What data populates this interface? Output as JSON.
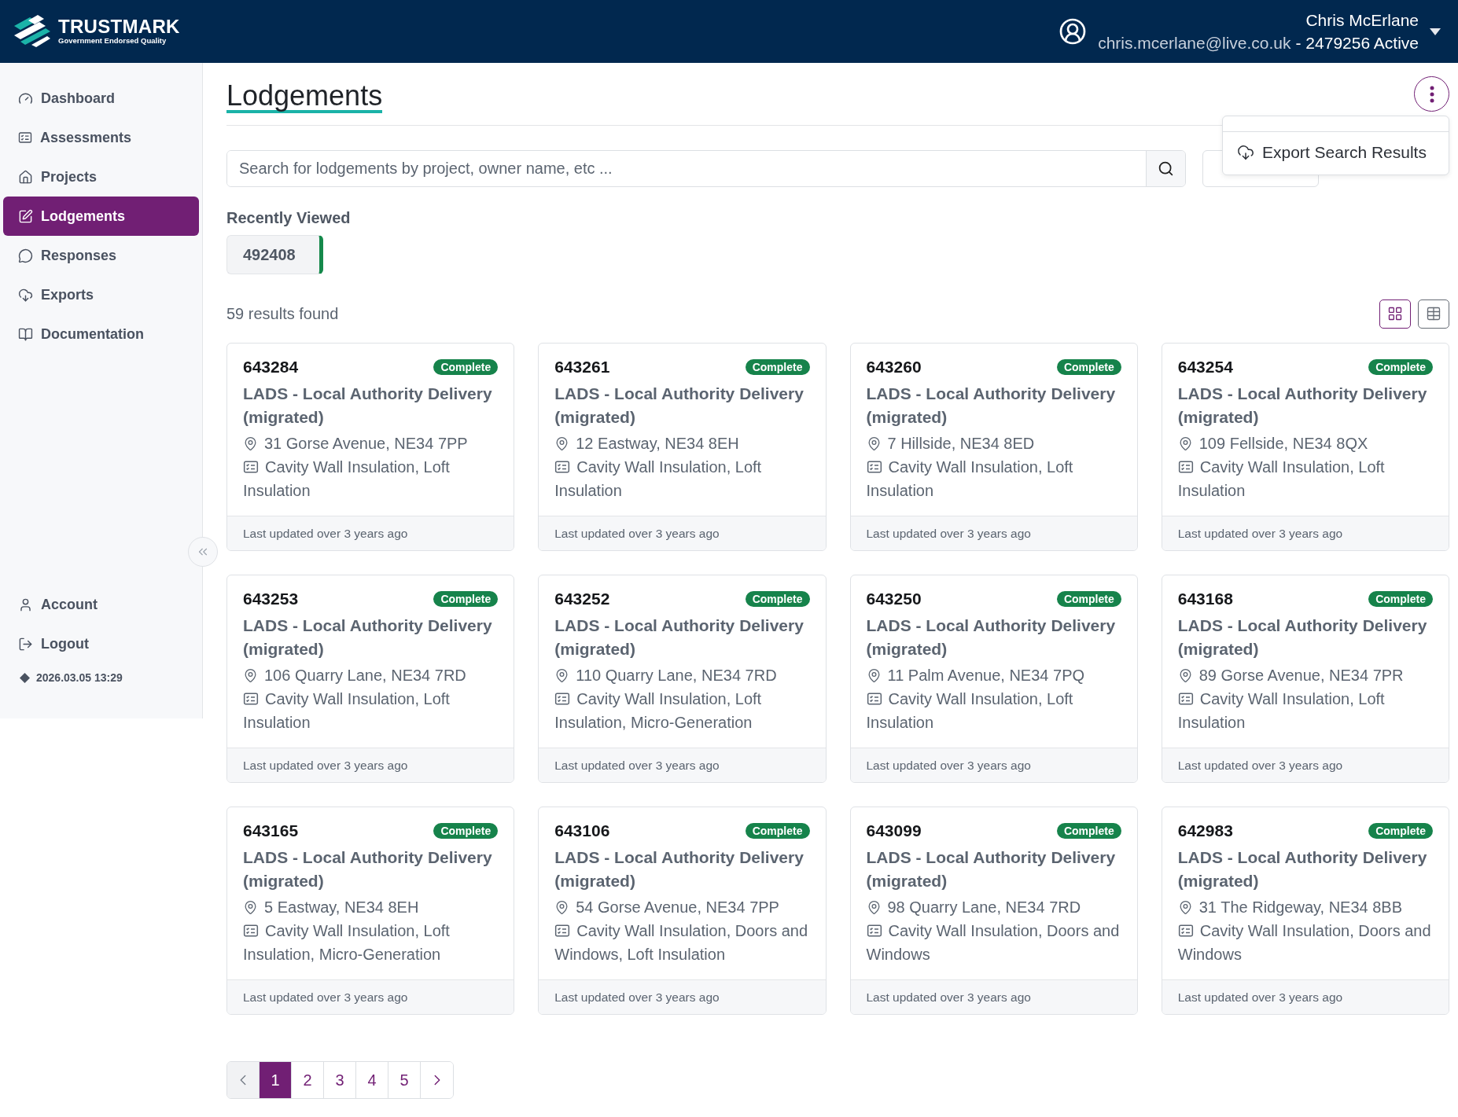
{
  "header": {
    "logo": {
      "name": "TRUSTMARK",
      "tagline": "Government Endorsed Quality"
    },
    "user": {
      "name": "Chris McErlane",
      "email": "chris.mcerlane@live.co.uk",
      "status": "- 2479256 Active"
    }
  },
  "sidebar": {
    "items": [
      {
        "label": "Dashboard",
        "selected": false
      },
      {
        "label": "Assessments",
        "selected": false
      },
      {
        "label": "Projects",
        "selected": false
      },
      {
        "label": "Lodgements",
        "selected": true
      },
      {
        "label": "Responses",
        "selected": false
      },
      {
        "label": "Exports",
        "selected": false
      },
      {
        "label": "Documentation",
        "selected": false
      }
    ],
    "footer_items": [
      {
        "label": "Account"
      },
      {
        "label": "Logout"
      }
    ],
    "version": "2026.03.05 13:29"
  },
  "page": {
    "title": "Lodgements",
    "actions_menu": {
      "open": true,
      "items": [
        {
          "label": "Export Search Results"
        }
      ]
    },
    "search": {
      "placeholder": "Search for lodgements by project, owner name, etc ..."
    },
    "recently_viewed": {
      "label": "Recently Viewed",
      "items": [
        "492408"
      ]
    },
    "results_count": "59 results found",
    "view_toggle": [
      {
        "kind": "grid",
        "selected": true
      },
      {
        "kind": "table",
        "selected": false
      }
    ],
    "cards": [
      {
        "id": "643284",
        "status": "Complete",
        "title": "LADS - Local Authority Delivery (migrated)",
        "address": "31 Gorse Avenue, NE34 7PP",
        "measures": "Cavity Wall Insulation, Loft Insulation",
        "updated": "Last updated over 3 years ago"
      },
      {
        "id": "643261",
        "status": "Complete",
        "title": "LADS - Local Authority Delivery (migrated)",
        "address": "12 Eastway, NE34 8EH",
        "measures": "Cavity Wall Insulation, Loft Insulation",
        "updated": "Last updated over 3 years ago"
      },
      {
        "id": "643260",
        "status": "Complete",
        "title": "LADS - Local Authority Delivery (migrated)",
        "address": "7 Hillside, NE34 8ED",
        "measures": "Cavity Wall Insulation, Loft Insulation",
        "updated": "Last updated over 3 years ago"
      },
      {
        "id": "643254",
        "status": "Complete",
        "title": "LADS - Local Authority Delivery (migrated)",
        "address": "109 Fellside, NE34 8QX",
        "measures": "Cavity Wall Insulation, Loft Insulation",
        "updated": "Last updated over 3 years ago"
      },
      {
        "id": "643253",
        "status": "Complete",
        "title": "LADS - Local Authority Delivery (migrated)",
        "address": "106 Quarry Lane, NE34 7RD",
        "measures": "Cavity Wall Insulation, Loft Insulation",
        "updated": "Last updated over 3 years ago"
      },
      {
        "id": "643252",
        "status": "Complete",
        "title": "LADS - Local Authority Delivery (migrated)",
        "address": "110 Quarry Lane, NE34 7RD",
        "measures": "Cavity Wall Insulation, Loft Insulation, Micro-Generation",
        "updated": "Last updated over 3 years ago"
      },
      {
        "id": "643250",
        "status": "Complete",
        "title": "LADS - Local Authority Delivery (migrated)",
        "address": "11 Palm Avenue, NE34 7PQ",
        "measures": "Cavity Wall Insulation, Loft Insulation",
        "updated": "Last updated over 3 years ago"
      },
      {
        "id": "643168",
        "status": "Complete",
        "title": "LADS - Local Authority Delivery (migrated)",
        "address": "89 Gorse Avenue, NE34 7PR",
        "measures": "Cavity Wall Insulation, Loft Insulation",
        "updated": "Last updated over 3 years ago"
      },
      {
        "id": "643165",
        "status": "Complete",
        "title": "LADS - Local Authority Delivery (migrated)",
        "address": "5 Eastway, NE34 8EH",
        "measures": "Cavity Wall Insulation, Loft Insulation, Micro-Generation",
        "updated": "Last updated over 3 years ago"
      },
      {
        "id": "643106",
        "status": "Complete",
        "title": "LADS - Local Authority Delivery (migrated)",
        "address": "54 Gorse Avenue, NE34 7PP",
        "measures": "Cavity Wall Insulation, Doors and Windows, Loft Insulation",
        "updated": "Last updated over 3 years ago"
      },
      {
        "id": "643099",
        "status": "Complete",
        "title": "LADS - Local Authority Delivery (migrated)",
        "address": "98 Quarry Lane, NE34 7RD",
        "measures": "Cavity Wall Insulation, Doors and Windows",
        "updated": "Last updated over 3 years ago"
      },
      {
        "id": "642983",
        "status": "Complete",
        "title": "LADS - Local Authority Delivery (migrated)",
        "address": "31 The Ridgeway, NE34 8BB",
        "measures": "Cavity Wall Insulation, Doors and Windows",
        "updated": "Last updated over 3 years ago"
      }
    ],
    "pagination": {
      "prev": {
        "disabled": true
      },
      "pages": [
        {
          "label": "1",
          "selected": true
        },
        {
          "label": "2",
          "selected": false
        },
        {
          "label": "3",
          "selected": false
        },
        {
          "label": "4",
          "selected": false
        },
        {
          "label": "5",
          "selected": false
        }
      ],
      "next": {
        "disabled": false
      }
    }
  }
}
